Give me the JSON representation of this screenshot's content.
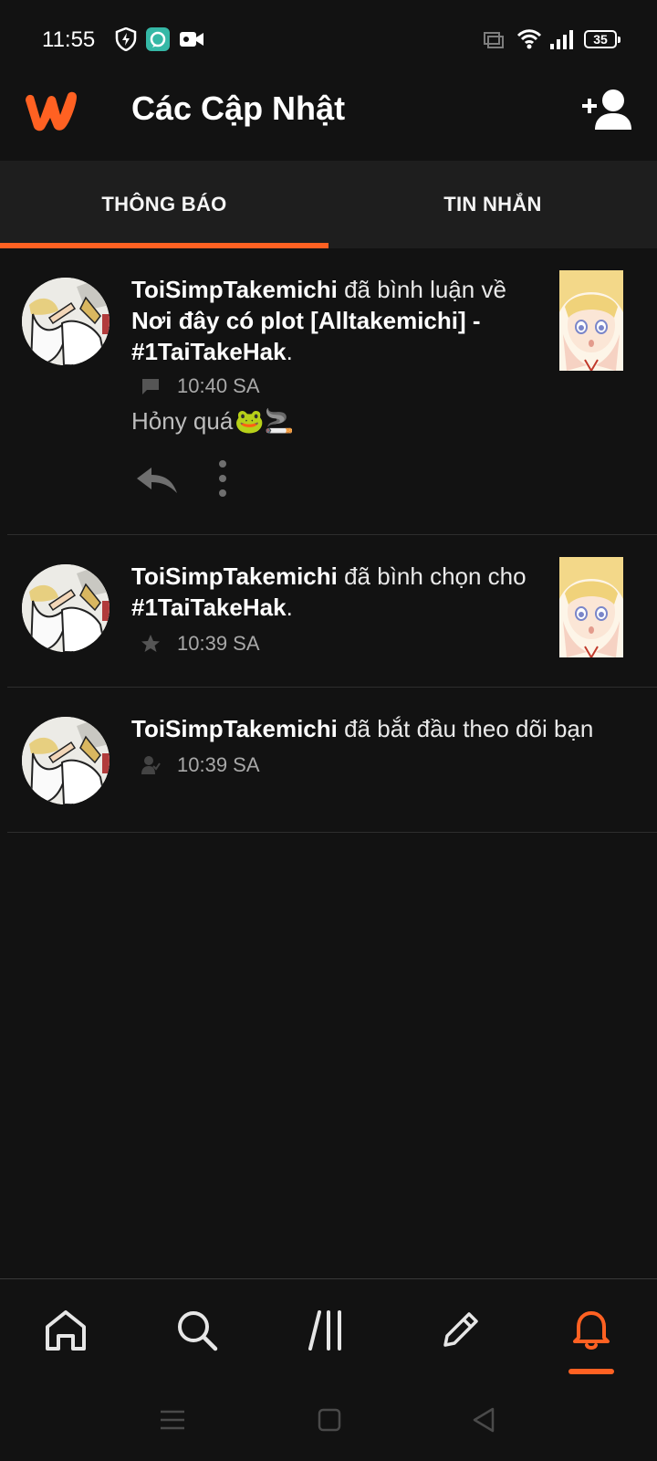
{
  "status_bar": {
    "time": "11:55",
    "battery": "35",
    "icons": [
      "shield-icon",
      "app-icon",
      "video-camera-icon",
      "cast-icon",
      "wifi-icon",
      "signal-icon",
      "battery-icon"
    ]
  },
  "header": {
    "title": "Các Cập Nhật",
    "logo": "wattpad-logo",
    "action_icon": "add-user-icon"
  },
  "tabs": [
    {
      "label": "THÔNG BÁO",
      "active": true
    },
    {
      "label": "TIN NHẮN",
      "active": false
    }
  ],
  "colors": {
    "accent": "#ff6122",
    "background": "#121212",
    "tab_bar": "#1e1e1e"
  },
  "notifications": [
    {
      "user": "ToiSimpTakemichi",
      "action": " đã bình luận về ",
      "target": "Nơi đây có plot [Alltakemichi] - #1TaiTakeHak",
      "end": ".",
      "type_icon": "comment-icon",
      "time": "10:40 SA",
      "comment": "Hỏny quá",
      "comment_emoji": "🐸🚬",
      "actions": [
        "reply-icon",
        "more-vertical-icon"
      ]
    },
    {
      "user": "ToiSimpTakemichi",
      "action": " đã bình chọn cho ",
      "target": "#1TaiTakeHak",
      "end": ".",
      "type_icon": "star-icon",
      "time": "10:39 SA"
    },
    {
      "user": "ToiSimpTakemichi",
      "action": " đã bắt đầu theo dõi bạn",
      "type_icon": "follow-user-icon",
      "time": "10:39 SA"
    }
  ],
  "bottom_nav": [
    {
      "icon": "home-icon",
      "active": false
    },
    {
      "icon": "search-icon",
      "active": false
    },
    {
      "icon": "library-icon",
      "active": false
    },
    {
      "icon": "pencil-icon",
      "active": false
    },
    {
      "icon": "bell-icon",
      "active": true
    }
  ],
  "system_nav": [
    "menu-icon",
    "home-square-icon",
    "back-triangle-icon"
  ]
}
